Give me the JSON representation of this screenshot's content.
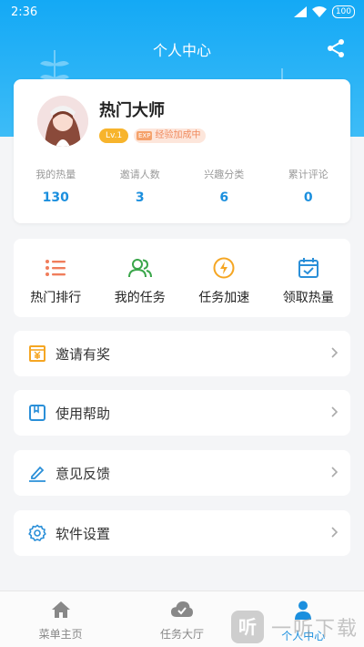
{
  "status_bar": {
    "time": "2:36",
    "battery": "100"
  },
  "header": {
    "title": "个人中心"
  },
  "profile": {
    "username": "热门大师",
    "level": "Lv.1",
    "exp_badge_icon": "EXP",
    "exp_text": "经验加成中",
    "stats": [
      {
        "label": "我的热量",
        "value": "130"
      },
      {
        "label": "邀请人数",
        "value": "3"
      },
      {
        "label": "兴趣分类",
        "value": "6"
      },
      {
        "label": "累计评论",
        "value": "0"
      }
    ]
  },
  "actions": [
    {
      "label": "热门排行",
      "icon": "list-icon",
      "color": "#f07d5b"
    },
    {
      "label": "我的任务",
      "icon": "users-icon",
      "color": "#3aa64a"
    },
    {
      "label": "任务加速",
      "icon": "lightning-icon",
      "color": "#f5a623"
    },
    {
      "label": "领取热量",
      "icon": "calendar-check-icon",
      "color": "#2a8fd8"
    }
  ],
  "menu": [
    {
      "label": "邀请有奖",
      "icon": "gift-icon",
      "color": "#f5a623"
    },
    {
      "label": "使用帮助",
      "icon": "book-icon",
      "color": "#2a8fd8"
    },
    {
      "label": "意见反馈",
      "icon": "edit-icon",
      "color": "#2a8fd8"
    },
    {
      "label": "软件设置",
      "icon": "gear-icon",
      "color": "#2a8fd8"
    }
  ],
  "tabs": [
    {
      "label": "菜单主页",
      "icon": "home-icon",
      "active": false
    },
    {
      "label": "任务大厅",
      "icon": "cloud-icon",
      "active": false
    },
    {
      "label": "个人中心",
      "icon": "person-icon",
      "active": true
    }
  ],
  "watermark": {
    "logo": "听",
    "text": "一听下载"
  },
  "colors": {
    "header": "#14a9f5",
    "accent": "#1b8fde"
  }
}
